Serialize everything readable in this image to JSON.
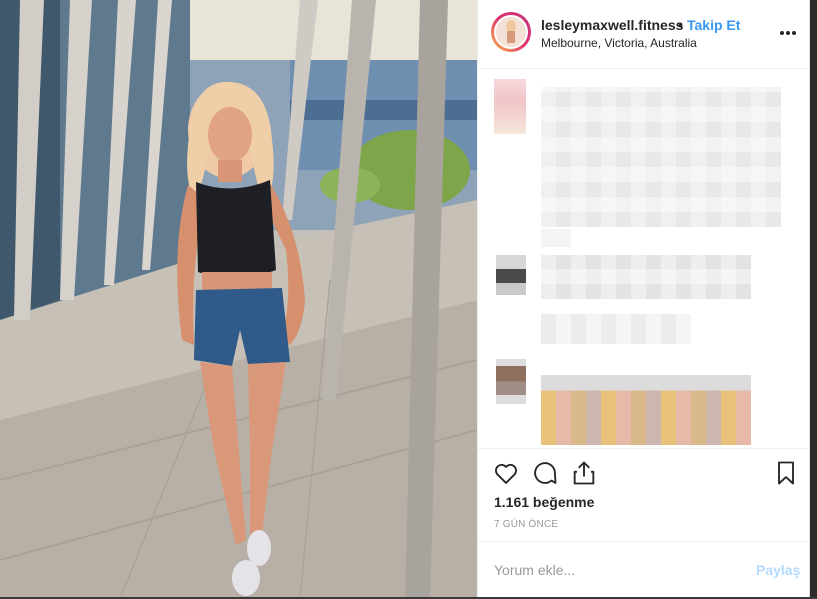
{
  "post": {
    "username": "lesleymaxwell.fitness",
    "separator": "•",
    "follow_label": "Takip Et",
    "location": "Melbourne, Victoria, Australia",
    "more_icon": "more-options-icon"
  },
  "engagement": {
    "likes_text": "1.161 beğenme",
    "time_ago": "7 GÜN ÖNCE"
  },
  "comment_box": {
    "placeholder": "Yorum ekle...",
    "post_label": "Paylaş"
  },
  "icons": {
    "like": "heart-icon",
    "comment": "comment-bubble-icon",
    "share": "share-icon",
    "save": "bookmark-icon"
  },
  "colors": {
    "link": "#3897f0",
    "post_disabled": "#b3dbff",
    "text": "#262626",
    "muted": "#999999"
  }
}
